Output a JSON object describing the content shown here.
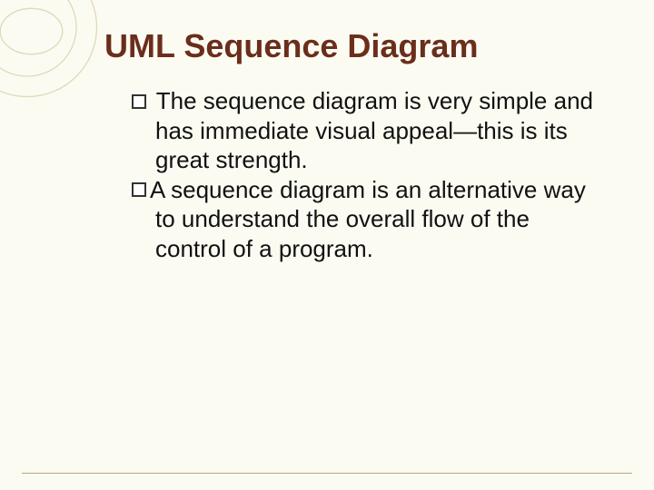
{
  "title": "UML Sequence Diagram",
  "bullets": [
    " The sequence diagram is very simple and has immediate visual appeal—this is its great strength.",
    "A sequence diagram is an alternative way to understand the overall flow of the control of a program."
  ]
}
